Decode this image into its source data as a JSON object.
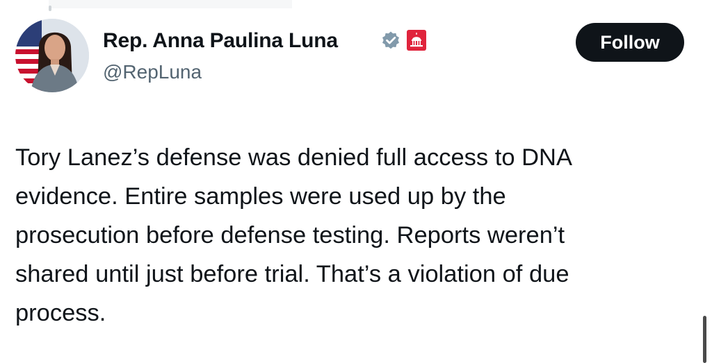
{
  "post": {
    "author": {
      "display_name": "Rep. Anna Paulina Luna",
      "handle": "@RepLuna",
      "verified_icon": "gray-verified-badge-icon",
      "affiliation_icon": "capitol-dome-badge-icon",
      "affiliation_color": "#e0243c"
    },
    "follow_label": "Follow",
    "text": "Tory Lanez’s defense was denied full access to DNA\nevidence. Entire samples were used up by the\nprosecution before defense testing. Reports weren’t\nshared until just before trial. That’s a violation of due\nprocess."
  },
  "colors": {
    "text": "#0f1419",
    "secondary_text": "#536471",
    "button_bg": "#0f1419",
    "button_text": "#ffffff",
    "verified_gray": "#829aab"
  }
}
